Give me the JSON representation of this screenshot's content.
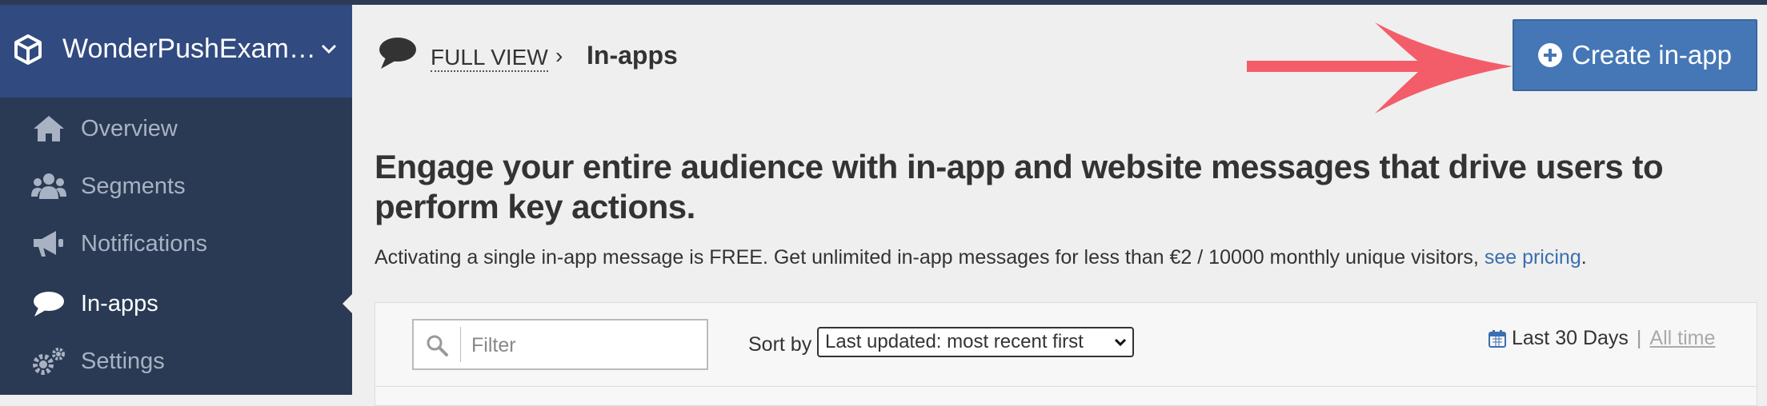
{
  "sidebar": {
    "app_name": "WonderPushExam…",
    "items": [
      {
        "label": "Overview",
        "icon": "home-icon"
      },
      {
        "label": "Segments",
        "icon": "users-icon"
      },
      {
        "label": "Notifications",
        "icon": "megaphone-icon"
      },
      {
        "label": "In-apps",
        "icon": "speech-bubble-icon",
        "active": true
      },
      {
        "label": "Settings",
        "icon": "gears-icon"
      }
    ]
  },
  "breadcrumb": {
    "link": "FULL VIEW",
    "separator": "›",
    "current": "In-apps"
  },
  "header": {
    "create_button": "Create in-app"
  },
  "main": {
    "headline": "Engage your entire audience with in-app and website messages that drive users to perform key actions.",
    "subline": "Activating a single in-app message is FREE. Get unlimited in-app messages for less than €2 / 10000 monthly unique visitors, ",
    "pricing_link": "see pricing",
    "subline_end": "."
  },
  "toolbar": {
    "filter_placeholder": "Filter",
    "sort_label": "Sort by",
    "sort_value": "Last updated: most recent first",
    "range_current": "Last 30 Days",
    "range_separator": "|",
    "range_alt": "All time"
  },
  "colors": {
    "sidebar": "#2a3a55",
    "sidebar_header": "#314a80",
    "button": "#4577b6",
    "arrow": "#f25d69",
    "link": "#3b6fb0"
  }
}
